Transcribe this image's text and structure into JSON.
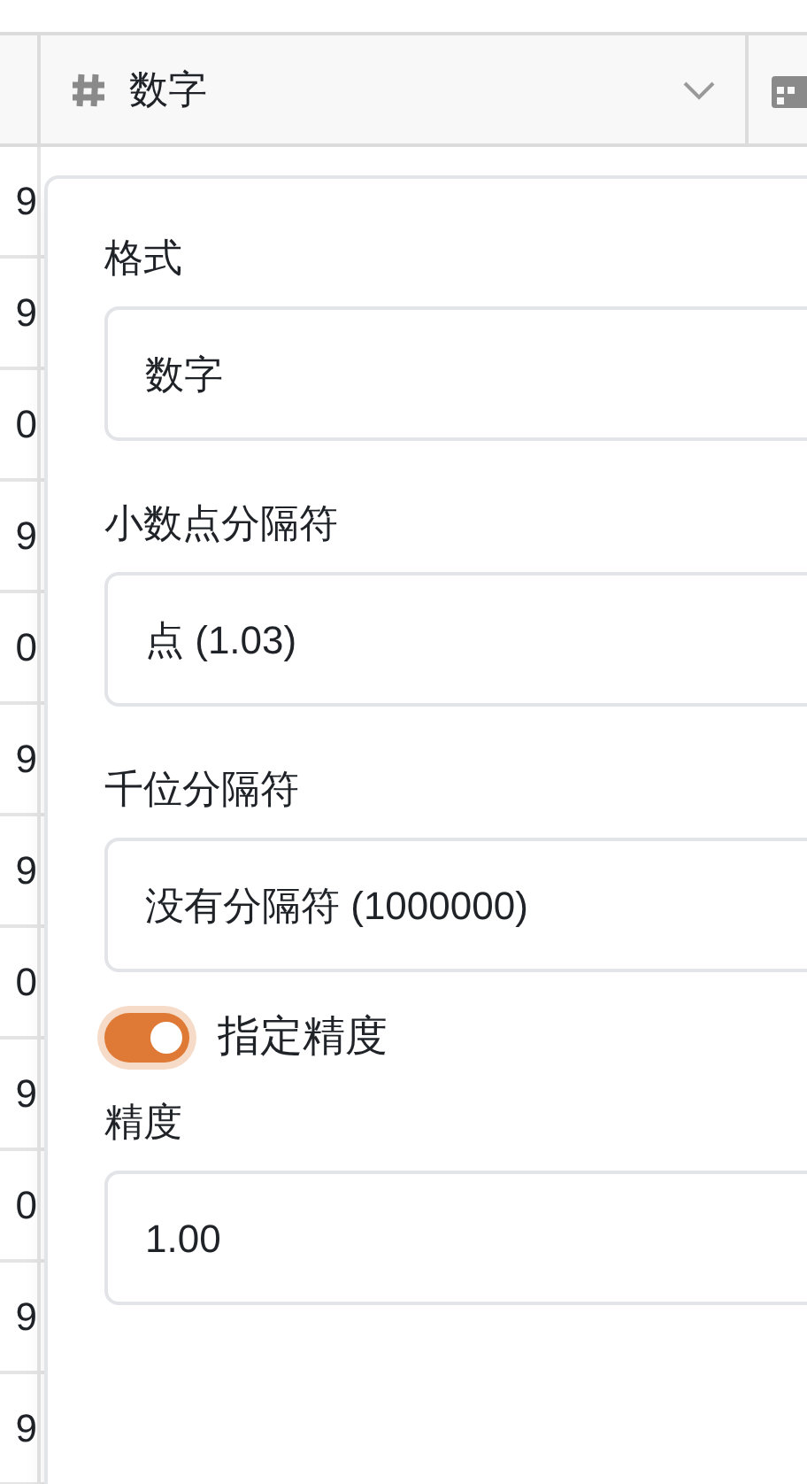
{
  "header": {
    "column_title": "数字"
  },
  "row_numbers": [
    "9",
    "9",
    "0",
    "9",
    "0",
    "9",
    "9",
    "0",
    "9",
    "0",
    "9",
    "9"
  ],
  "format_panel": {
    "fields": [
      {
        "label": "格式",
        "value": "数字"
      },
      {
        "label": "小数点分隔符",
        "value": "点 (1.03)"
      },
      {
        "label": "千位分隔符",
        "value": "没有分隔符 (1000000)"
      }
    ],
    "precision_toggle": {
      "label": "指定精度",
      "on": true
    },
    "precision": {
      "label": "精度",
      "value": "1.00"
    }
  }
}
